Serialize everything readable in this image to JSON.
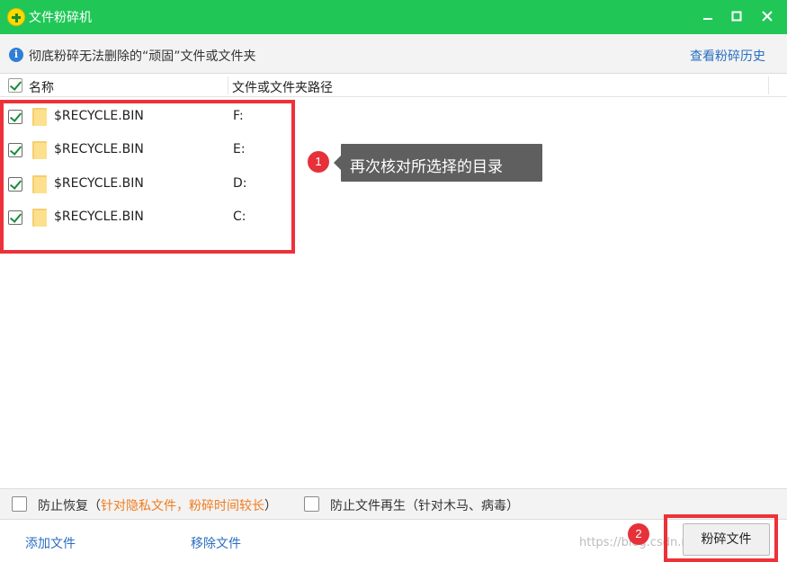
{
  "window": {
    "title": "文件粉碎机",
    "minimize_icon": "minimize-icon",
    "maximize_icon": "maximize-icon",
    "close_icon": "close-icon"
  },
  "infobar": {
    "text": "彻底粉碎无法删除的“顽固”文件或文件夹",
    "history_link": "查看粉碎历史"
  },
  "table": {
    "header": {
      "name": "名称",
      "path": "文件或文件夹路径",
      "all_checked": true
    },
    "rows": [
      {
        "name": "$RECYCLE.BIN",
        "path": "F:",
        "checked": true
      },
      {
        "name": "$RECYCLE.BIN",
        "path": "E:",
        "checked": true
      },
      {
        "name": "$RECYCLE.BIN",
        "path": "D:",
        "checked": true
      },
      {
        "name": "$RECYCLE.BIN",
        "path": "C:",
        "checked": true
      }
    ]
  },
  "callouts": [
    {
      "number": "1",
      "text": "再次核对所选择的目录"
    },
    {
      "number": "2"
    }
  ],
  "options": {
    "prevent_recovery": {
      "label": "防止恢复",
      "note_open": "（",
      "note": "针对隐私文件，粉碎时间较长",
      "note_close": "）",
      "checked": false
    },
    "prevent_regen": {
      "label": "防止文件再生",
      "note": "（针对木马、病毒）",
      "checked": false
    }
  },
  "footer": {
    "add_files": "添加文件",
    "remove_files": "移除文件",
    "shred_button": "粉碎文件",
    "watermark": "https://blog.csdn.net/...6"
  },
  "colors": {
    "titlebar": "#20c756",
    "highlight": "#ee3138",
    "link": "#2a6ec1",
    "note_orange": "#f07d1e"
  }
}
